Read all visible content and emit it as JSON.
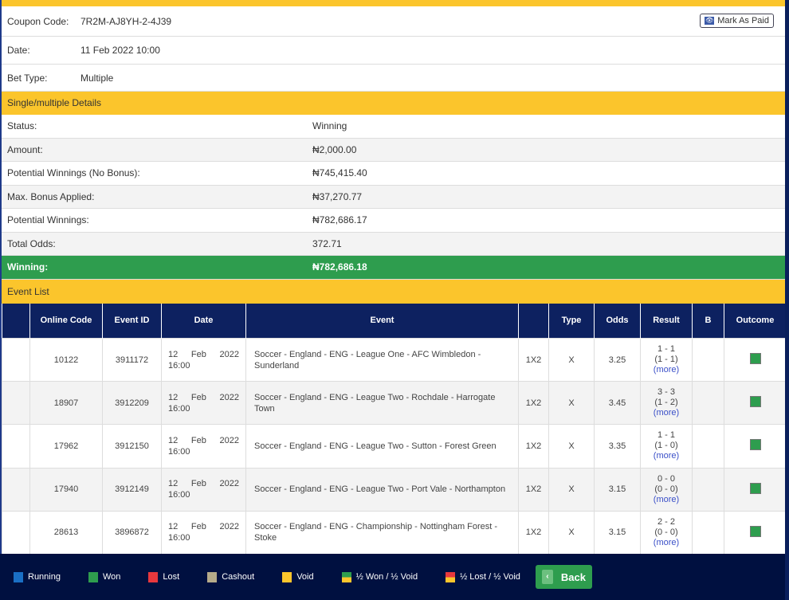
{
  "coupon": {
    "code_label": "Coupon Code:",
    "code": "7R2M-AJ8YH-2-4J39",
    "date_label": "Date:",
    "date": "11 Feb 2022 10:00",
    "bet_type_label": "Bet Type:",
    "bet_type": "Multiple",
    "mark_paid": "Mark As Paid"
  },
  "details": {
    "header": "Single/multiple Details",
    "rows": [
      {
        "label": "Status:",
        "value": "Winning"
      },
      {
        "label": "Amount:",
        "value": "₦2,000.00"
      },
      {
        "label": "Potential Winnings (No Bonus):",
        "value": "₦745,415.40"
      },
      {
        "label": "Max. Bonus Applied:",
        "value": "₦37,270.77"
      },
      {
        "label": "Potential Winnings:",
        "value": "₦782,686.17"
      },
      {
        "label": "Total Odds:",
        "value": "372.71"
      }
    ],
    "winning_label": "Winning:",
    "winning_value": "₦782,686.18"
  },
  "events": {
    "header": "Event List",
    "columns": [
      "",
      "Online Code",
      "Event ID",
      "Date",
      "Event",
      "",
      "Type",
      "Odds",
      "Result",
      "B",
      "Outcome"
    ],
    "rows": [
      {
        "code": "10122",
        "id": "3911172",
        "date": "12 Feb 2022 16:00",
        "event": "Soccer - England - ENG - League One - AFC Wimbledon - Sunderland",
        "market": "1X2",
        "type": "X",
        "odds": "3.25",
        "score": "1 - 1",
        "ht": "(1 - 1)",
        "more": "(more)",
        "outcome": "won"
      },
      {
        "code": "18907",
        "id": "3912209",
        "date": "12 Feb 2022 16:00",
        "event": "Soccer - England - ENG - League Two - Rochdale - Harrogate Town",
        "market": "1X2",
        "type": "X",
        "odds": "3.45",
        "score": "3 - 3",
        "ht": "(1 - 2)",
        "more": "(more)",
        "outcome": "won"
      },
      {
        "code": "17962",
        "id": "3912150",
        "date": "12 Feb 2022 16:00",
        "event": "Soccer - England - ENG - League Two - Sutton - Forest Green",
        "market": "1X2",
        "type": "X",
        "odds": "3.35",
        "score": "1 - 1",
        "ht": "(1 - 0)",
        "more": "(more)",
        "outcome": "won"
      },
      {
        "code": "17940",
        "id": "3912149",
        "date": "12 Feb 2022 16:00",
        "event": "Soccer - England - ENG - League Two - Port Vale - Northampton",
        "market": "1X2",
        "type": "X",
        "odds": "3.15",
        "score": "0 - 0",
        "ht": "(0 - 0)",
        "more": "(more)",
        "outcome": "won"
      },
      {
        "code": "28613",
        "id": "3896872",
        "date": "12 Feb 2022 16:00",
        "event": "Soccer - England - ENG - Championship - Nottingham Forest - Stoke",
        "market": "1X2",
        "type": "X",
        "odds": "3.15",
        "score": "2 - 2",
        "ht": "(0 - 0)",
        "more": "(more)",
        "outcome": "won"
      }
    ]
  },
  "legend": [
    {
      "label": "Running",
      "color": "#1a6fc4"
    },
    {
      "label": "Won",
      "color": "#2e9d4e"
    },
    {
      "label": "Lost",
      "color": "#e8383d"
    },
    {
      "label": "Cashout",
      "color": "#b5ab8a"
    },
    {
      "label": "Void",
      "color": "#fbc52c"
    },
    {
      "label": "½ Won / ½ Void",
      "color": "#2e9d4e",
      "color2": "#fbc52c"
    },
    {
      "label": "½ Lost / ½ Void",
      "color": "#e8383d",
      "color2": "#fbc52c"
    }
  ],
  "back_label": "Back"
}
